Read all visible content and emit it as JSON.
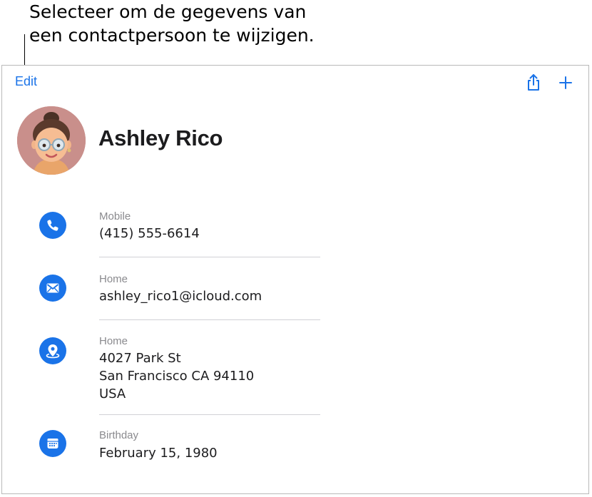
{
  "callout": {
    "text": "Selecteer om de gegevens van\neen contactpersoon te wijzigen."
  },
  "toolbar": {
    "edit_label": "Edit",
    "share_icon": "share-icon",
    "add_icon": "plus-icon"
  },
  "contact": {
    "name": "Ashley Rico",
    "fields": [
      {
        "label": "Mobile",
        "value": "(415) 555-6614",
        "icon": "phone-icon"
      },
      {
        "label": "Home",
        "value": "ashley_rico1@icloud.com",
        "icon": "envelope-icon"
      },
      {
        "label": "Home",
        "value": "4027 Park St\nSan Francisco CA 94110\nUSA",
        "icon": "map-pin-icon"
      },
      {
        "label": "Birthday",
        "value": "February 15, 1980",
        "icon": "calendar-icon"
      }
    ]
  },
  "colors": {
    "accent": "#1a73e8",
    "avatar_bg": "#c98f8b"
  }
}
